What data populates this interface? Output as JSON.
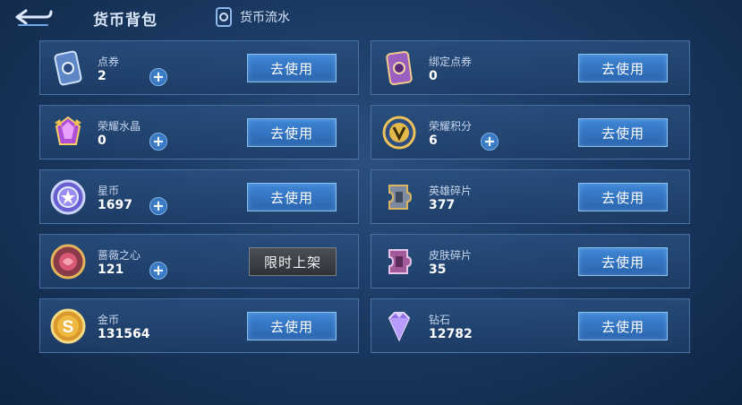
{
  "header": {
    "title": "货币背包",
    "flow_label": "货币流水",
    "back_icon": "back-arrow-icon"
  },
  "colors": {
    "use_button": "#3f86d6",
    "limited_button": "#3a3f47",
    "card_border": "#78a5e1"
  },
  "currencies": [
    {
      "name": "点券",
      "amount": "2",
      "action": "去使用",
      "icon": "coupon-card-icon",
      "plus": true
    },
    {
      "name": "绑定点券",
      "amount": "0",
      "action": "去使用",
      "icon": "bound-coupon-card-icon",
      "plus": false
    },
    {
      "name": "荣耀水晶",
      "amount": "0",
      "action": "去使用",
      "icon": "glory-crystal-icon",
      "plus": true
    },
    {
      "name": "荣耀积分",
      "amount": "6",
      "action": "去使用",
      "icon": "glory-points-icon",
      "plus": true
    },
    {
      "name": "星币",
      "amount": "1697",
      "action": "去使用",
      "icon": "star-coin-icon",
      "plus": true
    },
    {
      "name": "英雄碎片",
      "amount": "377",
      "action": "去使用",
      "icon": "hero-fragment-icon",
      "plus": false
    },
    {
      "name": "蔷薇之心",
      "amount": "121",
      "action": "限时上架",
      "icon": "rose-heart-icon",
      "plus": true
    },
    {
      "name": "皮肤碎片",
      "amount": "35",
      "action": "去使用",
      "icon": "skin-fragment-icon",
      "plus": false
    },
    {
      "name": "金币",
      "amount": "131564",
      "action": "去使用",
      "icon": "gold-coin-icon",
      "plus": false
    },
    {
      "name": "钻石",
      "amount": "12782",
      "action": "去使用",
      "icon": "diamond-icon",
      "plus": false
    }
  ]
}
